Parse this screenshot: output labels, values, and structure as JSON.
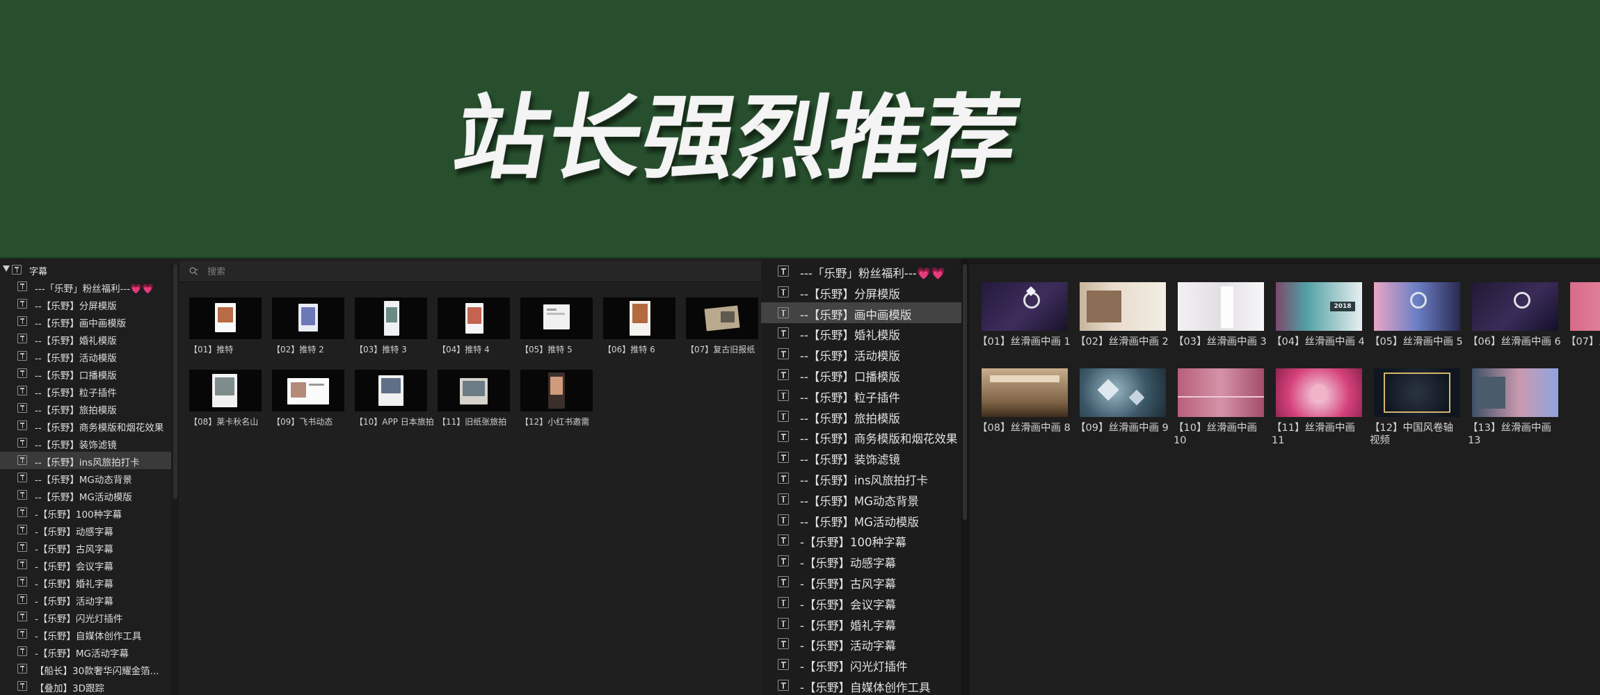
{
  "banner": {
    "title": "站长强烈推荐"
  },
  "left_tree": {
    "root_label": "字幕",
    "items": [
      "---「乐野」粉丝福利---💗💗",
      "--【乐野】分屏模版",
      "--【乐野】画中画模版",
      "--【乐野】婚礼模版",
      "--【乐野】活动模版",
      "--【乐野】口播模版",
      "--【乐野】粒子插件",
      "--【乐野】旅拍模版",
      "--【乐野】商务模版和烟花效果",
      "--【乐野】装饰滤镜",
      "--【乐野】ins风旅拍打卡",
      "--【乐野】MG动态背景",
      "--【乐野】MG活动模版",
      "-【乐野】100种字幕",
      "-【乐野】动感字幕",
      "-【乐野】古风字幕",
      "-【乐野】会议字幕",
      "-【乐野】婚礼字幕",
      "-【乐野】活动字幕",
      "-【乐野】闪光灯插件",
      "-【乐野】自媒体创作工具",
      "-【乐野】MG活动字幕",
      "【船长】30款奢华闪耀金箔...",
      "【叠加】3D跟踪"
    ],
    "selected_index": 10
  },
  "middle": {
    "search_placeholder": "搜索",
    "items": [
      "【01】推特",
      "【02】推特 2",
      "【03】推特 3",
      "【04】推特 4",
      "【05】推特 5",
      "【06】推特 6",
      "【07】复古旧报纸",
      "【08】莱卡秋名山",
      "【09】飞书动态",
      "【10】APP 日本旅拍",
      "【11】旧纸张旅拍",
      "【12】小红书邀需"
    ]
  },
  "right_tree": {
    "items": [
      "---「乐野」粉丝福利---💗💗",
      "--【乐野】分屏模版",
      "--【乐野】画中画模版",
      "--【乐野】婚礼模版",
      "--【乐野】活动模版",
      "--【乐野】口播模版",
      "--【乐野】粒子插件",
      "--【乐野】旅拍模版",
      "--【乐野】商务模版和烟花效果",
      "--【乐野】装饰滤镜",
      "--【乐野】ins风旅拍打卡",
      "--【乐野】MG动态背景",
      "--【乐野】MG活动模版",
      "-【乐野】100种字幕",
      "-【乐野】动感字幕",
      "-【乐野】古风字幕",
      "-【乐野】会议字幕",
      "-【乐野】婚礼字幕",
      "-【乐野】活动字幕",
      "-【乐野】闪光灯插件",
      "-【乐野】自媒体创作工具"
    ],
    "selected_index": 2
  },
  "right_browser": {
    "items": [
      "【01】丝滑画中画 1",
      "【02】丝滑画中画 2",
      "【03】丝滑画中画 3",
      "【04】丝滑画中画 4",
      "【05】丝滑画中画 5",
      "【06】丝滑画中画 6",
      "【07】丝",
      "【08】丝滑画中画 8",
      "【09】丝滑画中画 9",
      "【10】丝滑画中画 10",
      "【11】丝滑画中画 11",
      "【12】中国风卷轴视频",
      "【13】丝滑画中画 13"
    ],
    "thumb_text_04": "2018"
  },
  "colors": {
    "banner_bg": "#274f2e",
    "panel_bg": "#1e1e1e",
    "selection": "#3a3a3a",
    "text": "#dedede"
  },
  "icons": [
    "title-text-icon",
    "disclosure-triangle-icon",
    "search-icon"
  ]
}
